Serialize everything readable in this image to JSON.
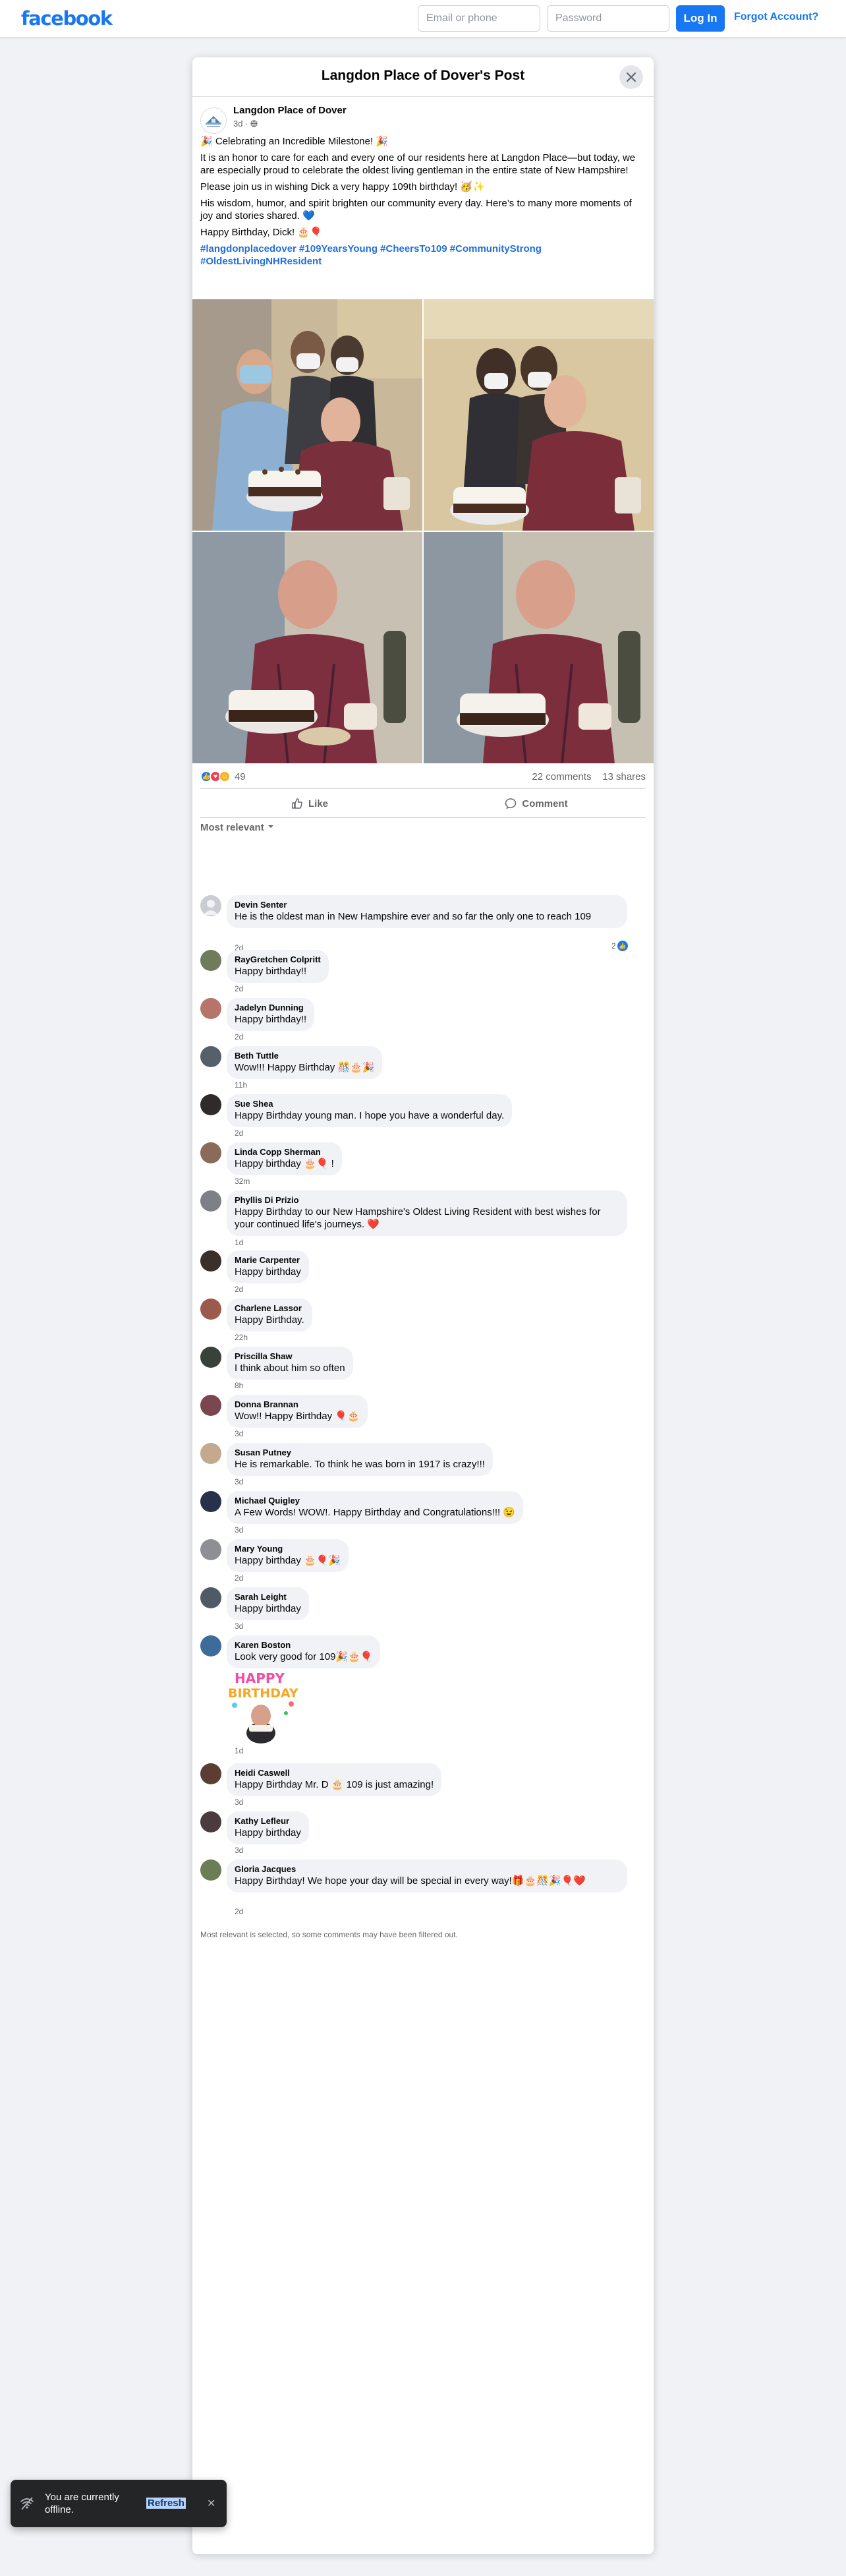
{
  "topbar": {
    "logo": "facebook",
    "email_placeholder": "Email or phone",
    "password_placeholder": "Password",
    "login_label": "Log In",
    "forgot_label": "Forgot Account?"
  },
  "post": {
    "header_title": "Langdon Place of Dover's Post",
    "author": "Langdon Place of Dover",
    "time": "3d",
    "time_separator": "·",
    "paragraphs": [
      "🎉 Celebrating an Incredible Milestone! 🎉",
      "It is an honor to care for each and every one of our residents here at Langdon Place—but today, we are especially proud to celebrate the oldest living gentleman in the entire state of New Hampshire!",
      "Please join us in wishing Dick a very happy 109th birthday! 🥳✨",
      "His wisdom, humor, and spirit brighten our community every day. Here’s to many more moments of joy and stories shared. 💙",
      "Happy Birthday, Dick! 🎂🎈"
    ],
    "hashtags": "#langdonplacedover #109YearsYoung #CheersTo109 #CommunityStrong #OldestLivingNHResident",
    "reaction_count": "49",
    "comments_count": "22 comments",
    "shares_count": "13 shares",
    "like_label": "Like",
    "comment_label": "Comment",
    "sort_label": "Most relevant"
  },
  "comments": [
    {
      "name": "Devin Senter",
      "text": "He is the oldest man in New Hampshire ever and so far the only one to reach 109",
      "time": "2d",
      "likes": "2"
    },
    {
      "name": "RayGretchen Colpritt",
      "text": "Happy birthday!!",
      "time": "2d"
    },
    {
      "name": "Jadelyn Dunning",
      "text": "Happy birthday!!",
      "time": "2d"
    },
    {
      "name": "Beth Tuttle",
      "text": "Wow!!! Happy Birthday 🎊🎂🎉",
      "time": "11h"
    },
    {
      "name": "Sue Shea",
      "text": "Happy Birthday young man. I hope you have a wonderful day.",
      "time": "2d"
    },
    {
      "name": "Linda Copp Sherman",
      "text": "Happy birthday 🎂🎈 !",
      "time": "32m"
    },
    {
      "name": "Phyllis Di Prizio",
      "text": "Happy Birthday to our New Hampshire's Oldest Living Resident with best wishes for your continued life's journeys. ❤️",
      "time": "1d"
    },
    {
      "name": "Marie Carpenter",
      "text": "Happy birthday",
      "time": "2d"
    },
    {
      "name": "Charlene Lassor",
      "text": "Happy Birthday.",
      "time": "22h"
    },
    {
      "name": "Priscilla Shaw",
      "text": "I think about him so often",
      "time": "8h"
    },
    {
      "name": "Donna Brannan",
      "text": "Wow!! Happy Birthday 🎈🎂",
      "time": "3d"
    },
    {
      "name": "Susan Putney",
      "text": "He is remarkable. To think he was born in 1917 is crazy!!!",
      "time": "3d"
    },
    {
      "name": "Michael Quigley",
      "text": "A Few Words! WOW!. Happy Birthday and Congratulations!!! 😉",
      "time": "3d"
    },
    {
      "name": "Mary Young",
      "text": "Happy birthday 🎂🎈🎉",
      "time": "2d"
    },
    {
      "name": "Sarah Leight",
      "text": "Happy birthday",
      "time": "3d"
    },
    {
      "name": "Karen Boston",
      "text": "Look very good for 109🎉🎂🎈",
      "time": "1d",
      "sticker_line1": "HAPPY",
      "sticker_line2": "BIRTHDAY"
    },
    {
      "name": "Heidi Caswell",
      "text": "Happy Birthday Mr. D 🎂 109 is just amazing!",
      "time": "3d"
    },
    {
      "name": "Kathy Lefleur",
      "text": "Happy birthday",
      "time": "3d"
    },
    {
      "name": "Gloria Jacques",
      "text": "Happy Birthday! We hope your day will be special in every way!🎁🎂🎊🎉🎈❤️",
      "time": "2d"
    }
  ],
  "filter_note": "Most relevant is selected, so some comments may have been filtered out.",
  "toast": {
    "text": "You are currently offline.",
    "action": "Refresh"
  },
  "colors": {
    "brand": "#1877f2",
    "link": "#216fdb",
    "page_bg": "#f0f2f5"
  }
}
